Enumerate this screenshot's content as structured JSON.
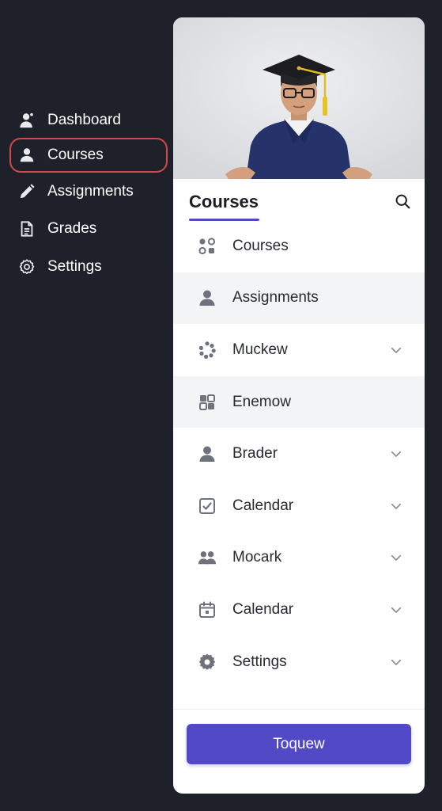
{
  "sidebar": {
    "items": [
      {
        "label": "Dashboard",
        "icon": "user-icon",
        "active": false
      },
      {
        "label": "Courses",
        "icon": "user-icon",
        "active": true
      },
      {
        "label": "Assignments",
        "icon": "pencil-icon",
        "active": false
      },
      {
        "label": "Grades",
        "icon": "document-icon",
        "active": false
      },
      {
        "label": "Settings",
        "icon": "gear-icon",
        "active": false
      }
    ],
    "active_outline_color": "#d0494e"
  },
  "panel": {
    "hero_image": "student-graduation-cap-photo",
    "title": "Courses",
    "accent_color": "#4f47c6",
    "search_icon": "search-icon",
    "items": [
      {
        "label": "Courses",
        "icon": "shapes-icon",
        "chevron": false,
        "shaded": false
      },
      {
        "label": "Assignments",
        "icon": "user-icon",
        "chevron": false,
        "shaded": true
      },
      {
        "label": "Muckew",
        "icon": "dots-circle-icon",
        "chevron": true,
        "shaded": false
      },
      {
        "label": "Enemow",
        "icon": "blocks-icon",
        "chevron": false,
        "shaded": true
      },
      {
        "label": "Brader",
        "icon": "user-icon",
        "chevron": true,
        "shaded": false
      },
      {
        "label": "Calendar",
        "icon": "checkbox-icon",
        "chevron": true,
        "shaded": false
      },
      {
        "label": "Mocark",
        "icon": "users-icon",
        "chevron": true,
        "shaded": false
      },
      {
        "label": "Calendar",
        "icon": "calendar-icon",
        "chevron": true,
        "shaded": false
      },
      {
        "label": "Settings",
        "icon": "gear-icon",
        "chevron": true,
        "shaded": false
      }
    ],
    "button_label": "Toquew",
    "button_color": "#5249c7"
  }
}
